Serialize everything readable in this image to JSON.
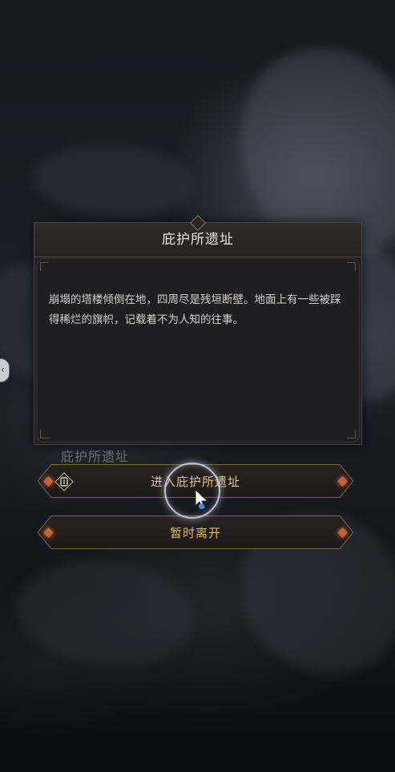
{
  "dialog": {
    "title": "庇护所遗址",
    "description": "崩塌的塔楼倾倒在地，四周尽是残垣断壁。地面上有一些被踩得稀烂的旗帜，记载着不为人知的往事。"
  },
  "location_label": "庇护所遗址",
  "actions": {
    "enter_label": "进入庇护所遗址",
    "leave_label": "暂时离开"
  },
  "icons": {
    "enter": "key-icon",
    "side": "chevron-left-icon",
    "cursor": "cursor-icon"
  },
  "colors": {
    "button_text": "#e4c488",
    "accent_gem": "#c4603a",
    "dialog_bg": "#1e1f22"
  }
}
